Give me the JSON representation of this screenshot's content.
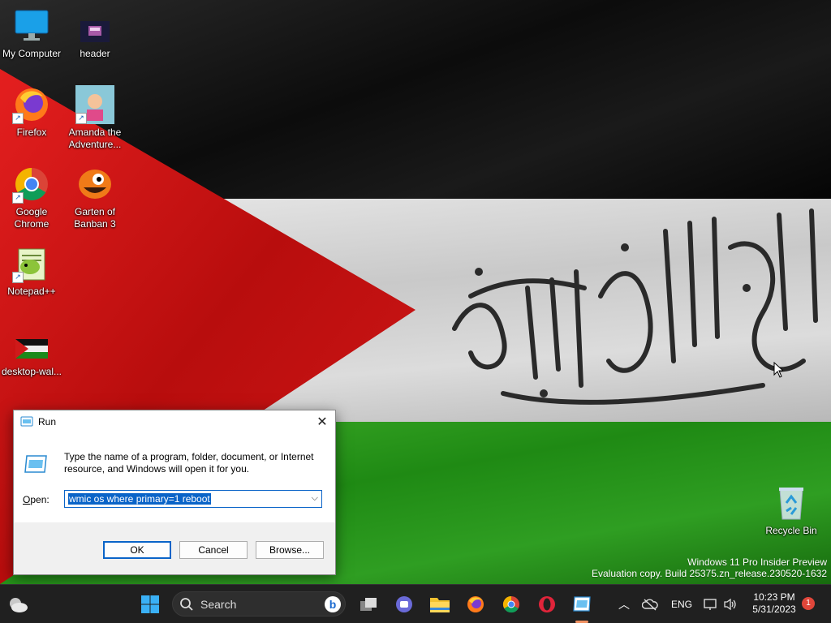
{
  "desktop": {
    "icons": [
      {
        "label": "My Computer",
        "icon": "monitor-icon"
      },
      {
        "label": "header",
        "icon": "image-file-icon"
      },
      {
        "label": "Firefox",
        "icon": "firefox-icon"
      },
      {
        "label": "Amanda the Adventure...",
        "icon": "game-icon"
      },
      {
        "label": "Google Chrome",
        "icon": "chrome-icon"
      },
      {
        "label": "Garten of Banban 3",
        "icon": "game-icon"
      },
      {
        "label": "Notepad++",
        "icon": "notepadpp-icon"
      },
      {
        "label": "desktop-wal...",
        "icon": "image-file-icon"
      },
      {
        "label": "Recycle Bin",
        "icon": "recycle-bin-icon"
      }
    ]
  },
  "run_dialog": {
    "title": "Run",
    "description": "Type the name of a program, folder, document, or Internet resource, and Windows will open it for you.",
    "open_label_mnemonic": "O",
    "open_label_rest": "pen:",
    "command_value": "wmic os where primary=1 reboot",
    "ok_label": "OK",
    "cancel_label": "Cancel",
    "browse_label": "Browse..."
  },
  "watermark": {
    "line1": "Windows 11 Pro Insider Preview",
    "line2": "Evaluation copy. Build 25375.zn_release.230520-1632"
  },
  "taskbar": {
    "search_placeholder": "Search",
    "pinned": [
      "start-icon",
      "task-view-icon",
      "chat-icon",
      "file-explorer-icon",
      "firefox-icon",
      "chrome-icon",
      "opera-icon",
      "run-icon"
    ],
    "language": "ENG",
    "time": "10:23 PM",
    "date": "5/31/2023",
    "notification_count": "1"
  },
  "colors": {
    "flag_red": "#d11a1a",
    "flag_green": "#229914",
    "selection_blue": "#0a64c8",
    "taskbar_bg": "#202020"
  }
}
